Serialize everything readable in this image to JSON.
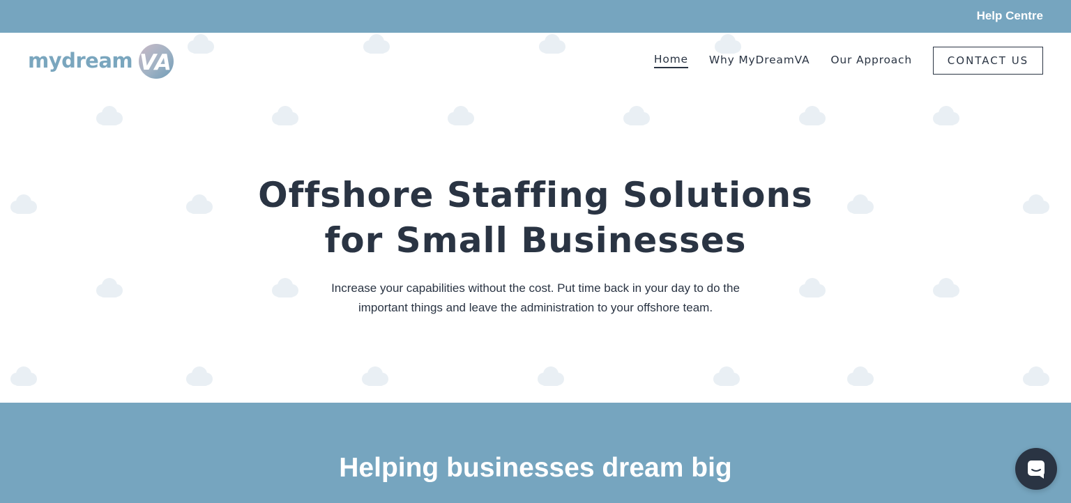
{
  "topbar": {
    "help_label": "Help Centre"
  },
  "logo": {
    "word_part1": "mydream",
    "badge_text": "VA"
  },
  "nav": {
    "items": [
      {
        "label": "Home",
        "active": true
      },
      {
        "label": "Why MyDreamVA",
        "active": false
      },
      {
        "label": "Our Approach",
        "active": false
      }
    ],
    "contact_label": "CONTACT US"
  },
  "hero": {
    "headline_line1": "Offshore Staffing Solutions",
    "headline_line2": "for Small Businesses",
    "subtext": "Increase your capabilities without the cost. Put time back in your day to do the important things and leave the administration to your offshore team."
  },
  "band": {
    "heading": "Helping businesses dream big"
  },
  "chat": {
    "icon": "chat-icon"
  },
  "colors": {
    "accent_blue": "#76a5bf",
    "text_dark": "#2a3443",
    "cloud": "#e9eff4"
  }
}
